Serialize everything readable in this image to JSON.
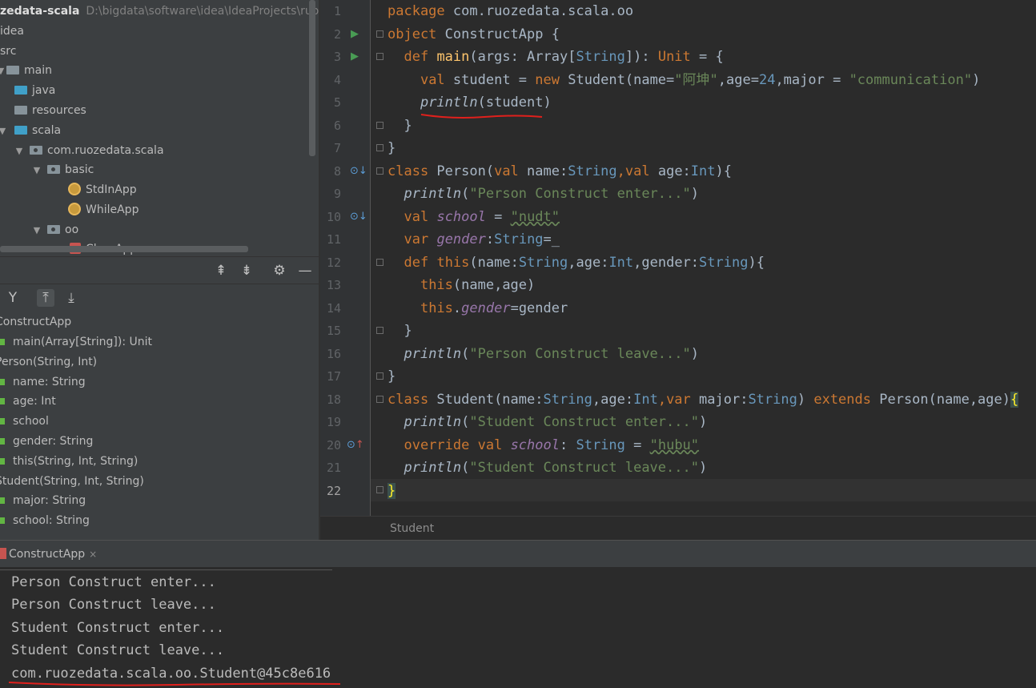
{
  "project": {
    "title": "zedata-scala",
    "path": "D:\\bigdata\\software\\idea\\IdeaProjects\\ruozed",
    "tree": [
      {
        "label": "idea",
        "type": "folder"
      },
      {
        "label": "src",
        "type": "folder"
      },
      {
        "label": "main",
        "type": "folder"
      },
      {
        "label": "java",
        "type": "source-folder"
      },
      {
        "label": "resources",
        "type": "resource-folder"
      },
      {
        "label": "scala",
        "type": "source-folder"
      },
      {
        "label": "com.ruozedata.scala",
        "type": "package"
      },
      {
        "label": "basic",
        "type": "package"
      },
      {
        "label": "StdInApp",
        "type": "scala-object"
      },
      {
        "label": "WhileApp",
        "type": "scala-object"
      },
      {
        "label": "oo",
        "type": "package"
      },
      {
        "label": "ClassApp",
        "type": "scala-class"
      }
    ]
  },
  "structure": {
    "items": [
      {
        "label": "ConstructApp",
        "level": 0
      },
      {
        "label": "main(Array[String]): Unit",
        "level": 1
      },
      {
        "label": "Person(String, Int)",
        "level": 0
      },
      {
        "label": "name: String",
        "level": 1
      },
      {
        "label": "age: Int",
        "level": 1
      },
      {
        "label": "school",
        "level": 1
      },
      {
        "label": "gender: String",
        "level": 1
      },
      {
        "label": "this(String, Int, String)",
        "level": 1
      },
      {
        "label": "Student(String, Int, String)",
        "level": 0
      },
      {
        "label": "major: String",
        "level": 1
      },
      {
        "label": "school: String",
        "level": 1
      }
    ]
  },
  "editor": {
    "line_numbers": [
      "1",
      "2",
      "3",
      "4",
      "5",
      "6",
      "7",
      "8",
      "9",
      "10",
      "11",
      "12",
      "13",
      "14",
      "15",
      "16",
      "17",
      "18",
      "19",
      "20",
      "21",
      "22"
    ],
    "current_line": "22",
    "code": {
      "l1_kw": "package",
      "l1_rest": " com.ruozedata.scala.oo",
      "l2_kw": "object",
      "l2_rest": " ConstructApp {",
      "l3_def": "def ",
      "l3_fn": "main",
      "l3_a": "(args: Array[",
      "l3_ty": "String",
      "l3_b": "]): ",
      "l3_ty2": "Unit",
      "l3_c": " = {",
      "l4_kw": "val",
      "l4_a": " student = ",
      "l4_new": "new",
      "l4_b": " Student(name=",
      "l4_s1": "\"阿坤\"",
      "l4_c": ",age=",
      "l4_n": "24",
      "l4_d": ",major = ",
      "l4_s2": "\"communication\"",
      "l4_e": ")",
      "l5_fn": "println",
      "l5_rest": "(student)",
      "l6": "}",
      "l7": "}",
      "l8_kw": "class",
      "l8_a": " Person(",
      "l8_val": "val",
      "l8_b": " name:",
      "l8_ty": "String",
      "l8_c": ",",
      "l8_val2": "val",
      "l8_d": " age:",
      "l8_ty2": "Int",
      "l8_e": "){",
      "l9_fn": "println",
      "l9_a": "(",
      "l9_s": "\"Person Construct enter...\"",
      "l9_b": ")",
      "l10_kw": "val",
      "l10_var": "school",
      "l10_a": " = ",
      "l10_s": "\"nudt\"",
      "l11_kw": "var",
      "l11_var": "gender",
      "l11_a": ":",
      "l11_ty": "String",
      "l11_b": "=_",
      "l12_kw": "def",
      "l12_this": "this",
      "l12_a": "(name:",
      "l12_ty": "String",
      "l12_b": ",age:",
      "l12_ty2": "Int",
      "l12_c": ",gender:",
      "l12_ty3": "String",
      "l12_d": "){",
      "l13_this": "this",
      "l13_rest": "(name,age)",
      "l14_this": "this",
      "l14_dot": ".",
      "l14_var": "gender",
      "l14_rest": "=gender",
      "l15": "}",
      "l16_fn": "println",
      "l16_a": "(",
      "l16_s": "\"Person Construct leave...\"",
      "l16_b": ")",
      "l17": "}",
      "l18_kw": "class",
      "l18_a": " Student(name:",
      "l18_ty": "String",
      "l18_b": ",age:",
      "l18_ty2": "Int",
      "l18_c": ",",
      "l18_var": "var",
      "l18_d": " major:",
      "l18_ty3": "String",
      "l18_e": ") ",
      "l18_ext": "extends",
      "l18_f": " Person(name,age)",
      "l18_brace": "{",
      "l19_fn": "println",
      "l19_a": "(",
      "l19_s": "\"Student Construct enter...\"",
      "l19_b": ")",
      "l20_kw": "override val",
      "l20_var": "school",
      "l20_a": ": ",
      "l20_ty": "String",
      "l20_b": " = ",
      "l20_s": "\"hubu\"",
      "l21_fn": "println",
      "l21_a": "(",
      "l21_s": "\"Student Construct leave...\"",
      "l21_b": ")",
      "l22": "}"
    },
    "breadcrumb": "Student"
  },
  "run": {
    "tab_label": "ConstructApp",
    "close": "×",
    "output": [
      "Person Construct enter...",
      "Person Construct leave...",
      "Student Construct enter...",
      "Student Construct leave...",
      "com.ruozedata.scala.oo.Student@45c8e616"
    ]
  },
  "colors": {
    "editor_bg": "#2b2b2b",
    "panel_bg": "#3c3f41",
    "keyword": "#cc7832",
    "string": "#6a8759",
    "annotation_red": "#e0201c"
  }
}
